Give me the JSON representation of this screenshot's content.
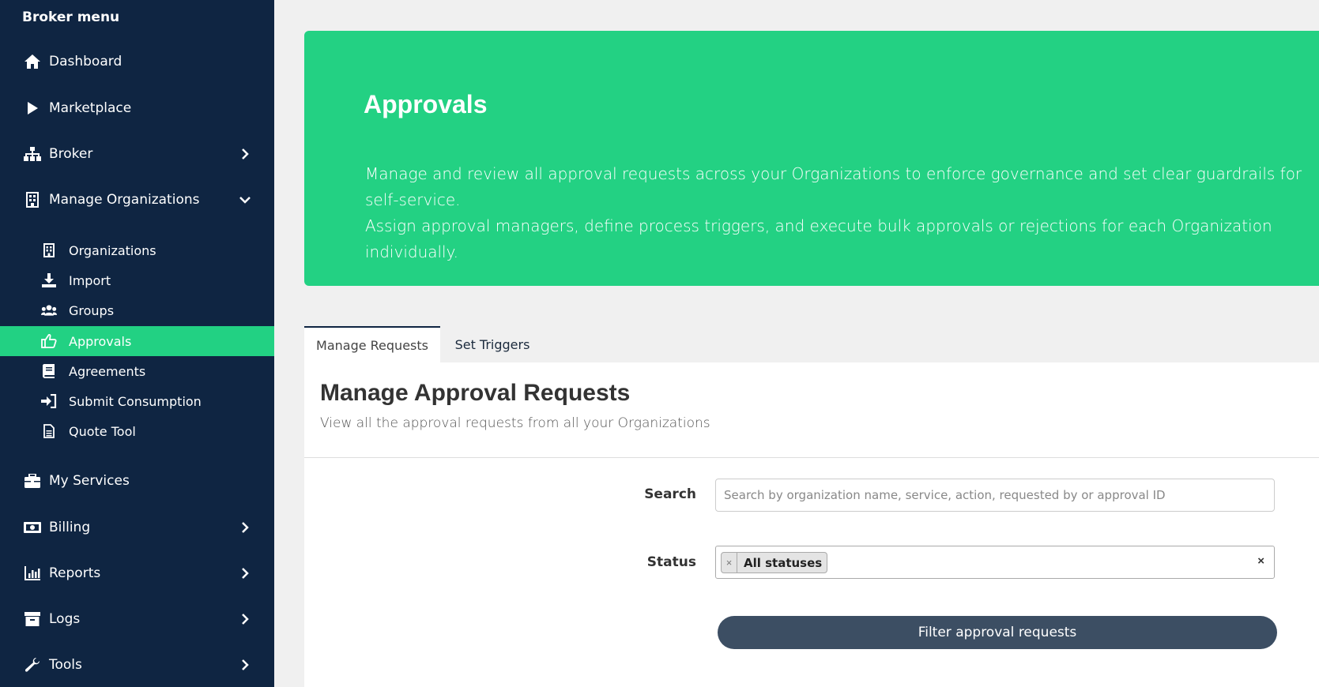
{
  "sidebar": {
    "title": "Broker menu",
    "items": [
      {
        "label": "Dashboard",
        "icon": "home-icon"
      },
      {
        "label": "Marketplace",
        "icon": "play-icon"
      },
      {
        "label": "Broker",
        "icon": "sitemap-icon"
      },
      {
        "label": "Manage Organizations",
        "icon": "building-icon"
      },
      {
        "label": "My Services",
        "icon": "briefcase-icon"
      },
      {
        "label": "Billing",
        "icon": "money-icon"
      },
      {
        "label": "Reports",
        "icon": "chart-icon"
      },
      {
        "label": "Logs",
        "icon": "archive-icon"
      },
      {
        "label": "Tools",
        "icon": "wrench-icon"
      }
    ],
    "subitems": [
      {
        "label": "Organizations",
        "icon": "building-icon"
      },
      {
        "label": "Import",
        "icon": "download-icon"
      },
      {
        "label": "Groups",
        "icon": "users-icon"
      },
      {
        "label": "Approvals",
        "icon": "thumbs-up-icon",
        "active": true
      },
      {
        "label": "Agreements",
        "icon": "book-icon"
      },
      {
        "label": "Submit Consumption",
        "icon": "sign-in-icon"
      },
      {
        "label": "Quote Tool",
        "icon": "file-icon"
      }
    ]
  },
  "hero": {
    "title": "Approvals",
    "line1": "Manage and review all approval requests across your Organizations to enforce governance and set clear guardrails for self-service.",
    "line2": "Assign approval managers, define process triggers, and execute bulk approvals or rejections for each Organization individually."
  },
  "tabs": {
    "manage": "Manage Requests",
    "triggers": "Set Triggers"
  },
  "panel": {
    "title": "Manage Approval Requests",
    "subtitle": "View all the approval requests from all your Organizations",
    "search_label": "Search",
    "search_placeholder": "Search by organization name, service, action, requested by or approval ID",
    "search_value": "",
    "status_label": "Status",
    "status_chip": "All statuses",
    "chip_remove": "×",
    "clear": "×",
    "filter_button": "Filter approval requests"
  },
  "colors": {
    "sidebar_bg": "#0f2542",
    "accent": "#23d183",
    "button": "#3c4e63"
  }
}
